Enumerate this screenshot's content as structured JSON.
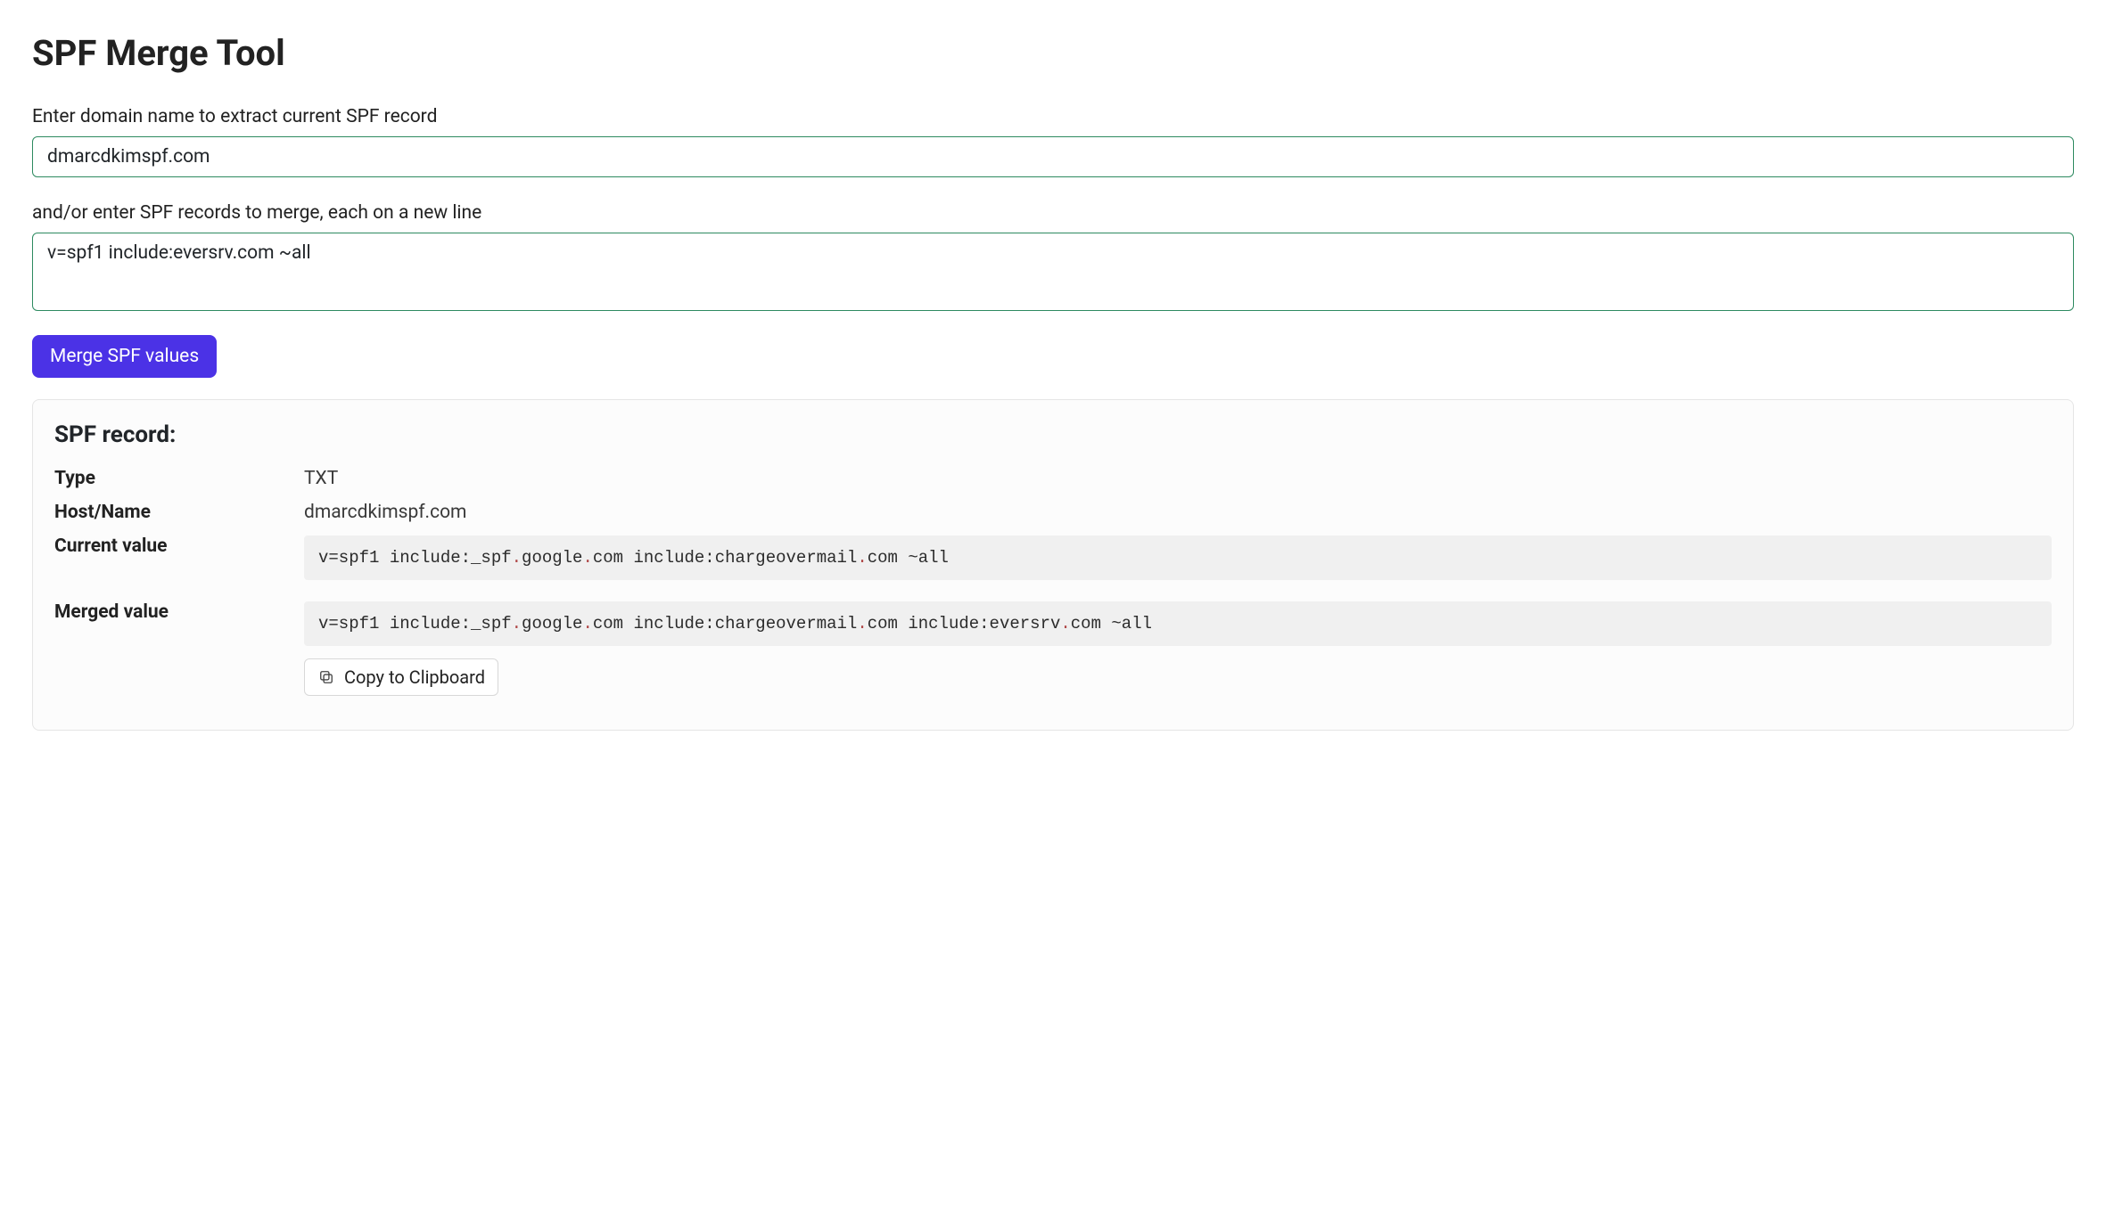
{
  "page": {
    "title": "SPF Merge Tool"
  },
  "form": {
    "domain_label": "Enter domain name to extract current SPF record",
    "domain_value": "dmarcdkimspf.com",
    "records_label": "and/or enter SPF records to merge, each on a new line",
    "records_value": "v=spf1 include:eversrv.com ~all",
    "merge_button": "Merge SPF values"
  },
  "result": {
    "heading": "SPF record:",
    "type_label": "Type",
    "type_value": "TXT",
    "host_label": "Host/Name",
    "host_value": "dmarcdkimspf.com",
    "current_label": "Current value",
    "current_value": "v=spf1 include:_spf.google.com include:chargeovermail.com ~all",
    "merged_label": "Merged value",
    "merged_value": "v=spf1 include:_spf.google.com include:chargeovermail.com include:eversrv.com ~all",
    "copy_button": "Copy to Clipboard"
  }
}
